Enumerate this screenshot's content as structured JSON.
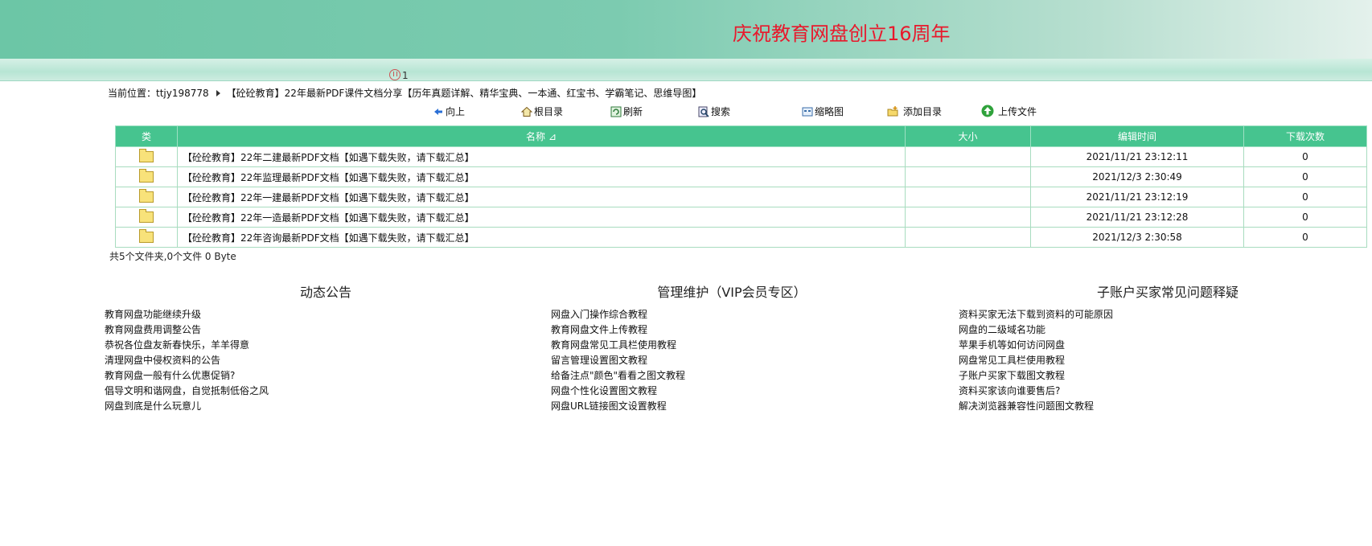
{
  "header": {
    "banner": "庆祝教育网盘创立16周年",
    "counter": "1"
  },
  "breadcrumb": {
    "label": "当前位置：",
    "user": "ttjy198778",
    "folder": "【砼砼教育】22年最新PDF课件文档分享【历年真题详解、精华宝典、一本通、红宝书、学霸笔记、思维导图】"
  },
  "toolbar": {
    "up": "向上",
    "root": "根目录",
    "refresh": "刷新",
    "search": "搜索",
    "thumbnail": "缩略图",
    "add_dir": "添加目录",
    "upload": "上传文件"
  },
  "table": {
    "headers": {
      "type": "类",
      "name": "名称",
      "size": "大小",
      "time": "编辑时间",
      "downloads": "下载次数"
    },
    "rows": [
      {
        "name": "【砼砼教育】22年二建最新PDF文档【如遇下载失败，请下载汇总】",
        "size": "",
        "time": "2021/11/21 23:12:11",
        "downloads": "0"
      },
      {
        "name": "【砼砼教育】22年监理最新PDF文档【如遇下载失败，请下载汇总】",
        "size": "",
        "time": "2021/12/3 2:30:49",
        "downloads": "0"
      },
      {
        "name": "【砼砼教育】22年一建最新PDF文档【如遇下载失败，请下载汇总】",
        "size": "",
        "time": "2021/11/21 23:12:19",
        "downloads": "0"
      },
      {
        "name": "【砼砼教育】22年一造最新PDF文档【如遇下载失败，请下载汇总】",
        "size": "",
        "time": "2021/11/21 23:12:28",
        "downloads": "0"
      },
      {
        "name": "【砼砼教育】22年咨询最新PDF文档【如遇下载失败，请下载汇总】",
        "size": "",
        "time": "2021/12/3 2:30:58",
        "downloads": "0"
      }
    ]
  },
  "summary": "共5个文件夹,0个文件 0 Byte",
  "columns": {
    "announcements": {
      "title": "动态公告",
      "items": [
        "教育网盘功能继续升级",
        "教育网盘费用调整公告",
        "恭祝各位盘友新春快乐，羊羊得意",
        "清理网盘中侵权资料的公告",
        "教育网盘一般有什么优惠促销?",
        "倡导文明和谐网盘，自觉抵制低俗之风",
        "网盘到底是什么玩意儿"
      ]
    },
    "maintenance": {
      "title": "管理维护（VIP会员专区）",
      "items": [
        "网盘入门操作综合教程",
        "教育网盘文件上传教程",
        "教育网盘常见工具栏使用教程",
        "留言管理设置图文教程",
        "给备注点\"颜色\"看看之图文教程",
        "网盘个性化设置图文教程",
        "网盘URL链接图文设置教程"
      ]
    },
    "faq": {
      "title": "子账户买家常见问题释疑",
      "items": [
        "资料买家无法下载到资料的可能原因",
        "网盘的二级域名功能",
        "苹果手机等如何访问网盘",
        "网盘常见工具栏使用教程",
        "子账户买家下载图文教程",
        "资料买家该向谁要售后?",
        "解决浏览器兼容性问题图文教程"
      ]
    }
  }
}
